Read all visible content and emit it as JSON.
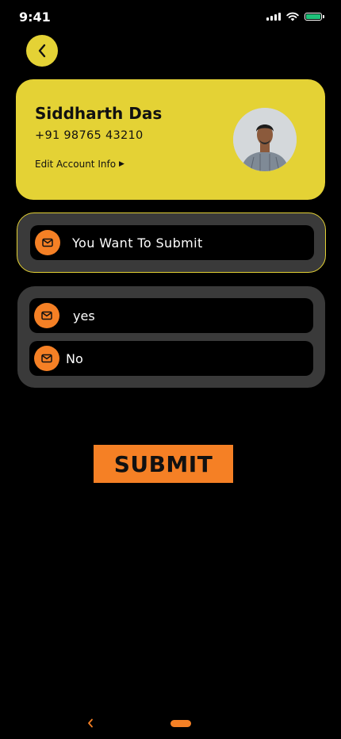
{
  "status_bar": {
    "time": "9:41",
    "icons": [
      "signal-icon",
      "wifi-icon",
      "battery-icon"
    ],
    "battery_color": "#1ec27a"
  },
  "back_button": {
    "icon": "chevron-left-icon"
  },
  "profile": {
    "name": "Siddharth Das",
    "phone": "+91 98765 43210",
    "edit_link": "Edit Account Info",
    "edit_link_icon": "chevron-right-icon",
    "avatar_icon": "person-photo",
    "card_color": "#e4d235"
  },
  "question": {
    "text": "You Want To Submit",
    "icon": "mail-icon"
  },
  "options": [
    {
      "label": "yes",
      "icon": "mail-icon"
    },
    {
      "label": "No",
      "icon": "mail-icon"
    }
  ],
  "submit": {
    "label": "SUBMIT",
    "color": "#f58025"
  },
  "bottom_nav": {
    "back_icon": "chevron-left-icon",
    "accent": "#f58025"
  }
}
